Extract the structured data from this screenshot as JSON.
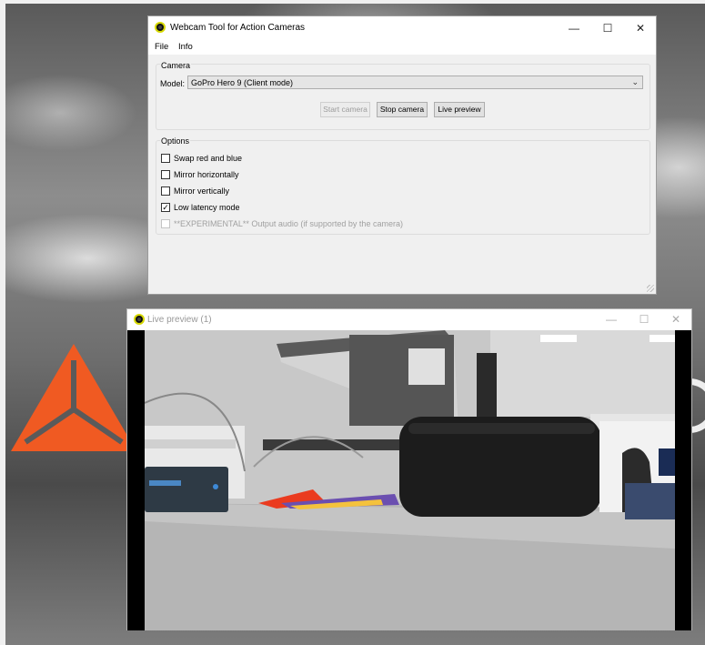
{
  "main_window": {
    "title": "Webcam Tool for Action Cameras",
    "controls": {
      "minimize": "—",
      "maximize": "☐",
      "close": "✕"
    },
    "menu": [
      "File",
      "Info"
    ],
    "camera_group": {
      "label": "Camera",
      "model_label": "Model:",
      "model_value": "GoPro Hero 9 (Client mode)",
      "buttons": {
        "start": "Start camera",
        "stop": "Stop camera",
        "preview": "Live preview"
      }
    },
    "options_group": {
      "label": "Options",
      "items": [
        {
          "label": "Swap red and blue",
          "checked": false,
          "enabled": true
        },
        {
          "label": "Mirror horizontally",
          "checked": false,
          "enabled": true
        },
        {
          "label": "Mirror vertically",
          "checked": false,
          "enabled": true
        },
        {
          "label": "Low latency mode",
          "checked": true,
          "enabled": true
        },
        {
          "label": "**EXPERIMENTAL** Output audio (if supported by the camera)",
          "checked": false,
          "enabled": false
        }
      ]
    }
  },
  "preview_window": {
    "title": "Live preview (1)",
    "controls": {
      "minimize": "—",
      "maximize": "☐",
      "close": "✕"
    }
  },
  "colors": {
    "logo_orange": "#f05a22",
    "window_bg": "#f0f0f0",
    "titlebar_bg": "#ffffff"
  }
}
